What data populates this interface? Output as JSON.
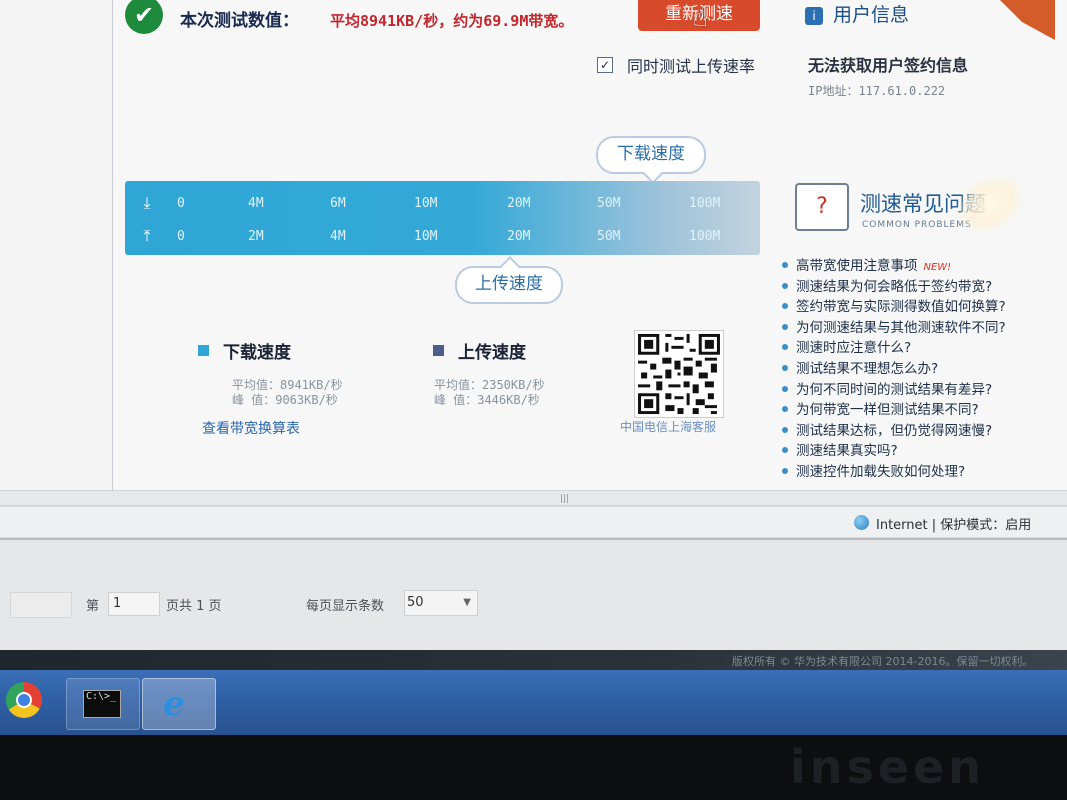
{
  "header": {
    "result_label": "本次测试数值：",
    "result_value": "平均8941KB/秒，约为69.9M带宽。",
    "retest_button": "重新测速",
    "user_info_title": "用户信息",
    "upload_checkbox_label": "同时测试上传速率",
    "upload_checkbox_checked": true,
    "contract_info": "无法获取用户签约信息",
    "ip_line": "IP地址：117.61.0.222"
  },
  "speed_meter": {
    "download_bubble": "下载速度",
    "upload_bubble": "上传速度",
    "download_ticks": [
      "0",
      "4M",
      "6M",
      "10M",
      "20M",
      "50M",
      "100M"
    ],
    "upload_ticks": [
      "0",
      "2M",
      "4M",
      "10M",
      "20M",
      "50M",
      "100M"
    ]
  },
  "faq": {
    "title": "测速常见问题",
    "subtitle": "COMMON PROBLEMS",
    "new_badge": "NEW!",
    "items": [
      "高带宽使用注意事项",
      "测速结果为何会略低于签约带宽?",
      "签约带宽与实际测得数值如何换算?",
      "为何测速结果与其他测速软件不同?",
      "测速时应注意什么?",
      "测试结果不理想怎么办?",
      "为何不同时间的测试结果有差异?",
      "为何带宽一样但测试结果不同?",
      "测试结果达标，但仍觉得网速慢?",
      "测速结果真实吗?",
      "测速控件加载失败如何处理?"
    ]
  },
  "stats": {
    "download": {
      "title": "下载速度",
      "avg": "平均值：8941KB/秒",
      "peak": "峰  值：9063KB/秒",
      "color": "#2fa6d6"
    },
    "upload": {
      "title": "上传速度",
      "avg": "平均值：2350KB/秒",
      "peak": "峰  值：3446KB/秒",
      "color": "#4b5f8a"
    },
    "convert_link": "查看带宽换算表",
    "qr_caption": "中国电信上海客服"
  },
  "statusbar": {
    "zone": "Internet",
    "separator": "|",
    "mode": "保护模式：启用"
  },
  "pager": {
    "page_prefix": "第",
    "page_value": "1",
    "page_suffix": "页共 1 页",
    "per_page_label": "每页显示条数",
    "per_page_value": "50"
  },
  "footer": {
    "copyright": "版权所有 © 华为技术有限公司 2014-2016。保留一切权利。"
  },
  "taskbar": {
    "cmd_text": "C:\\>_"
  },
  "bezel": {
    "brand": "inseen"
  }
}
